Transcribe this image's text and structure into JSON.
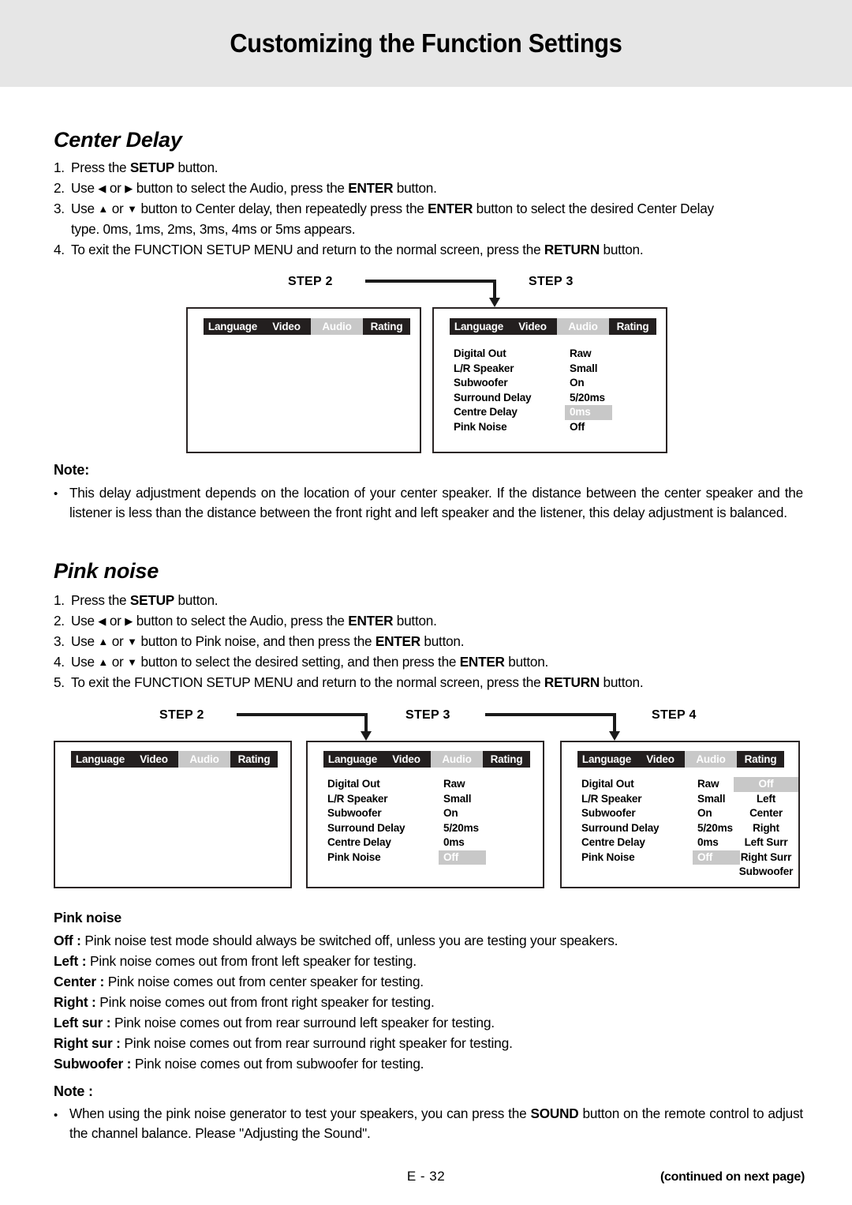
{
  "header": {
    "title": "Customizing the Function Settings"
  },
  "center_delay": {
    "heading": "Center Delay",
    "steps": [
      {
        "num": "1.",
        "html": "Press the <b>SETUP</b> button."
      },
      {
        "num": "2.",
        "html": "Use <span class=\"arrow-g\">&#9664;</span> or <span class=\"arrow-g\">&#9654;</span> button to select the Audio, press the <b>ENTER</b> button."
      },
      {
        "num": "3.",
        "html": "Use <span class=\"arrow-g\">&#9650;</span> or <span class=\"arrow-g\">&#9660;</span> button to Center delay, then repeatedly press the <b>ENTER</b> button to select the desired Center Delay"
      },
      {
        "num": "",
        "html": "type. 0ms, 1ms, 2ms, 3ms, 4ms or 5ms appears."
      },
      {
        "num": "4.",
        "html": "To exit the FUNCTION SETUP MENU and return to the normal screen, press the <b>RETURN</b> button."
      }
    ]
  },
  "note1": {
    "heading": "Note:",
    "bullet": "•",
    "text": "This delay adjustment depends on the location of your center speaker. If the distance between the center speaker and the listener is less than the distance between the front right and left speaker and the listener, this delay adjustment is balanced."
  },
  "pink_noise": {
    "heading": "Pink noise",
    "steps": [
      {
        "num": "1.",
        "html": "Press the <b>SETUP</b> button."
      },
      {
        "num": "2.",
        "html": "Use <span class=\"arrow-g\">&#9664;</span> or <span class=\"arrow-g\">&#9654;</span> button to select the Audio, press the <b>ENTER</b> button."
      },
      {
        "num": "3.",
        "html": "Use <span class=\"arrow-g\">&#9650;</span> or <span class=\"arrow-g\">&#9660;</span> button to Pink noise, and then press the <b>ENTER</b> button."
      },
      {
        "num": "4.",
        "html": "Use <span class=\"arrow-g\">&#9650;</span> or <span class=\"arrow-g\">&#9660;</span> button to select the desired setting, and then press the <b>ENTER</b> button."
      },
      {
        "num": "5.",
        "html": "To exit the FUNCTION SETUP MENU and return to the normal screen, press the <b>RETURN</b> button."
      }
    ]
  },
  "osd": {
    "tabs": [
      {
        "label": "Language",
        "selected": false
      },
      {
        "label": "Video",
        "selected": false
      },
      {
        "label": "Audio",
        "selected": true
      },
      {
        "label": "Rating",
        "selected": false
      }
    ],
    "rows": [
      "Digital Out",
      "L/R Speaker",
      "Subwoofer",
      "Surround Delay",
      "Centre Delay",
      "Pink Noise"
    ],
    "values_centre_highlight": [
      {
        "text": "Raw",
        "highlight": false
      },
      {
        "text": "Small",
        "highlight": false
      },
      {
        "text": "On",
        "highlight": false
      },
      {
        "text": "5/20ms",
        "highlight": false
      },
      {
        "text": "0ms",
        "highlight": true
      },
      {
        "text": "Off",
        "highlight": false
      }
    ],
    "values_pink_highlight": [
      {
        "text": "Raw",
        "highlight": false
      },
      {
        "text": "Small",
        "highlight": false
      },
      {
        "text": "On",
        "highlight": false
      },
      {
        "text": "5/20ms",
        "highlight": false
      },
      {
        "text": "0ms",
        "highlight": false
      },
      {
        "text": "Off",
        "highlight": true
      }
    ],
    "pink_options": [
      {
        "text": "Off",
        "highlight": true
      },
      {
        "text": "Left",
        "highlight": false
      },
      {
        "text": "Center",
        "highlight": false
      },
      {
        "text": "Right",
        "highlight": false
      },
      {
        "text": "Left Surr",
        "highlight": false
      },
      {
        "text": "Right Surr",
        "highlight": false
      },
      {
        "text": "Subwoofer",
        "highlight": false
      }
    ]
  },
  "diagram1": {
    "step_labels": [
      "STEP 2",
      "STEP 3"
    ]
  },
  "diagram2": {
    "step_labels": [
      "STEP 2",
      "STEP 3",
      "STEP 4"
    ]
  },
  "pink_definitions": {
    "heading": "Pink noise",
    "items": [
      {
        "term": "Off :",
        "desc": " Pink noise test mode should always be switched off, unless you are testing your speakers."
      },
      {
        "term": "Left :",
        "desc": " Pink noise comes out from front left speaker for testing."
      },
      {
        "term": "Center :",
        "desc": " Pink noise comes out from center speaker for testing."
      },
      {
        "term": "Right :",
        "desc": " Pink noise comes out from front right speaker for testing."
      },
      {
        "term": "Left sur :",
        "desc": "  Pink noise comes out from rear surround left speaker for testing."
      },
      {
        "term": "Right sur :",
        "desc": " Pink noise comes out from rear surround right speaker for testing."
      },
      {
        "term": "Subwoofer :",
        "desc": " Pink noise comes out from subwoofer for testing."
      }
    ]
  },
  "note2": {
    "heading": "Note :",
    "bullet": "•",
    "html": "When using the pink noise generator to test your speakers, you can press the <b>SOUND</b> button on the remote control to adjust the channel balance. Please \"Adjusting the Sound\"."
  },
  "footer": {
    "page_number": "E - 32",
    "continued": "(continued on next page)"
  }
}
